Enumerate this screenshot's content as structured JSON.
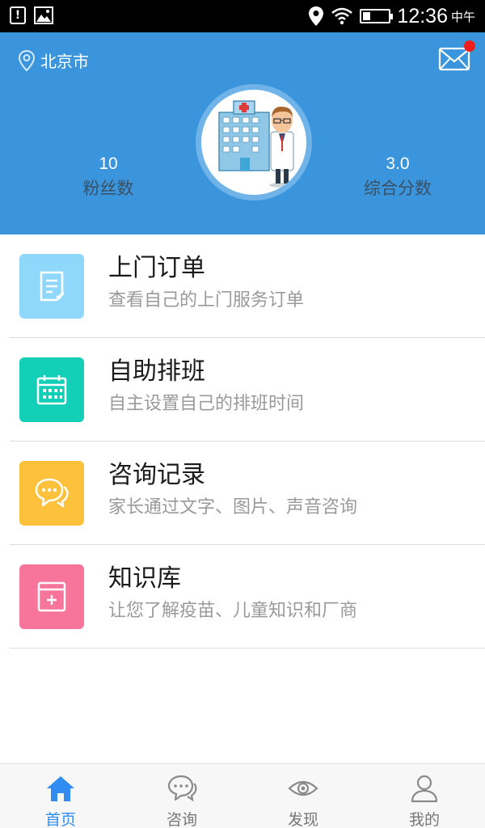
{
  "status_bar": {
    "time": "12:36",
    "period": "中午",
    "battery_level": 0.3
  },
  "header": {
    "location": "北京市",
    "has_unread_message": true,
    "stats": [
      {
        "value": "10",
        "label": "粉丝数"
      },
      {
        "value": "3.0",
        "label": "综合分数"
      }
    ],
    "colors": {
      "background": "#3a95dd",
      "badge": "#f01c1c"
    }
  },
  "menu": {
    "items": [
      {
        "title": "上门订单",
        "subtitle": "查看自己的上门服务订单",
        "icon": "order-document-icon",
        "color": "#8fd8fb"
      },
      {
        "title": "自助排班",
        "subtitle": "自主设置自己的排班时间",
        "icon": "calendar-icon",
        "color": "#14cfb7"
      },
      {
        "title": "咨询记录",
        "subtitle": "家长通过文字、图片、声音咨询",
        "icon": "chat-bubbles-icon",
        "color": "#fdc13b"
      },
      {
        "title": "知识库",
        "subtitle": "让您了解疫苗、儿童知识和厂商",
        "icon": "knowledge-box-icon",
        "color": "#f7749a"
      }
    ]
  },
  "bottom_nav": {
    "active_index": 0,
    "active_color": "#2f8cf0",
    "items": [
      {
        "label": "首页",
        "icon": "home-icon"
      },
      {
        "label": "咨询",
        "icon": "chat-icon"
      },
      {
        "label": "发现",
        "icon": "eye-icon"
      },
      {
        "label": "我的",
        "icon": "user-icon"
      }
    ]
  }
}
